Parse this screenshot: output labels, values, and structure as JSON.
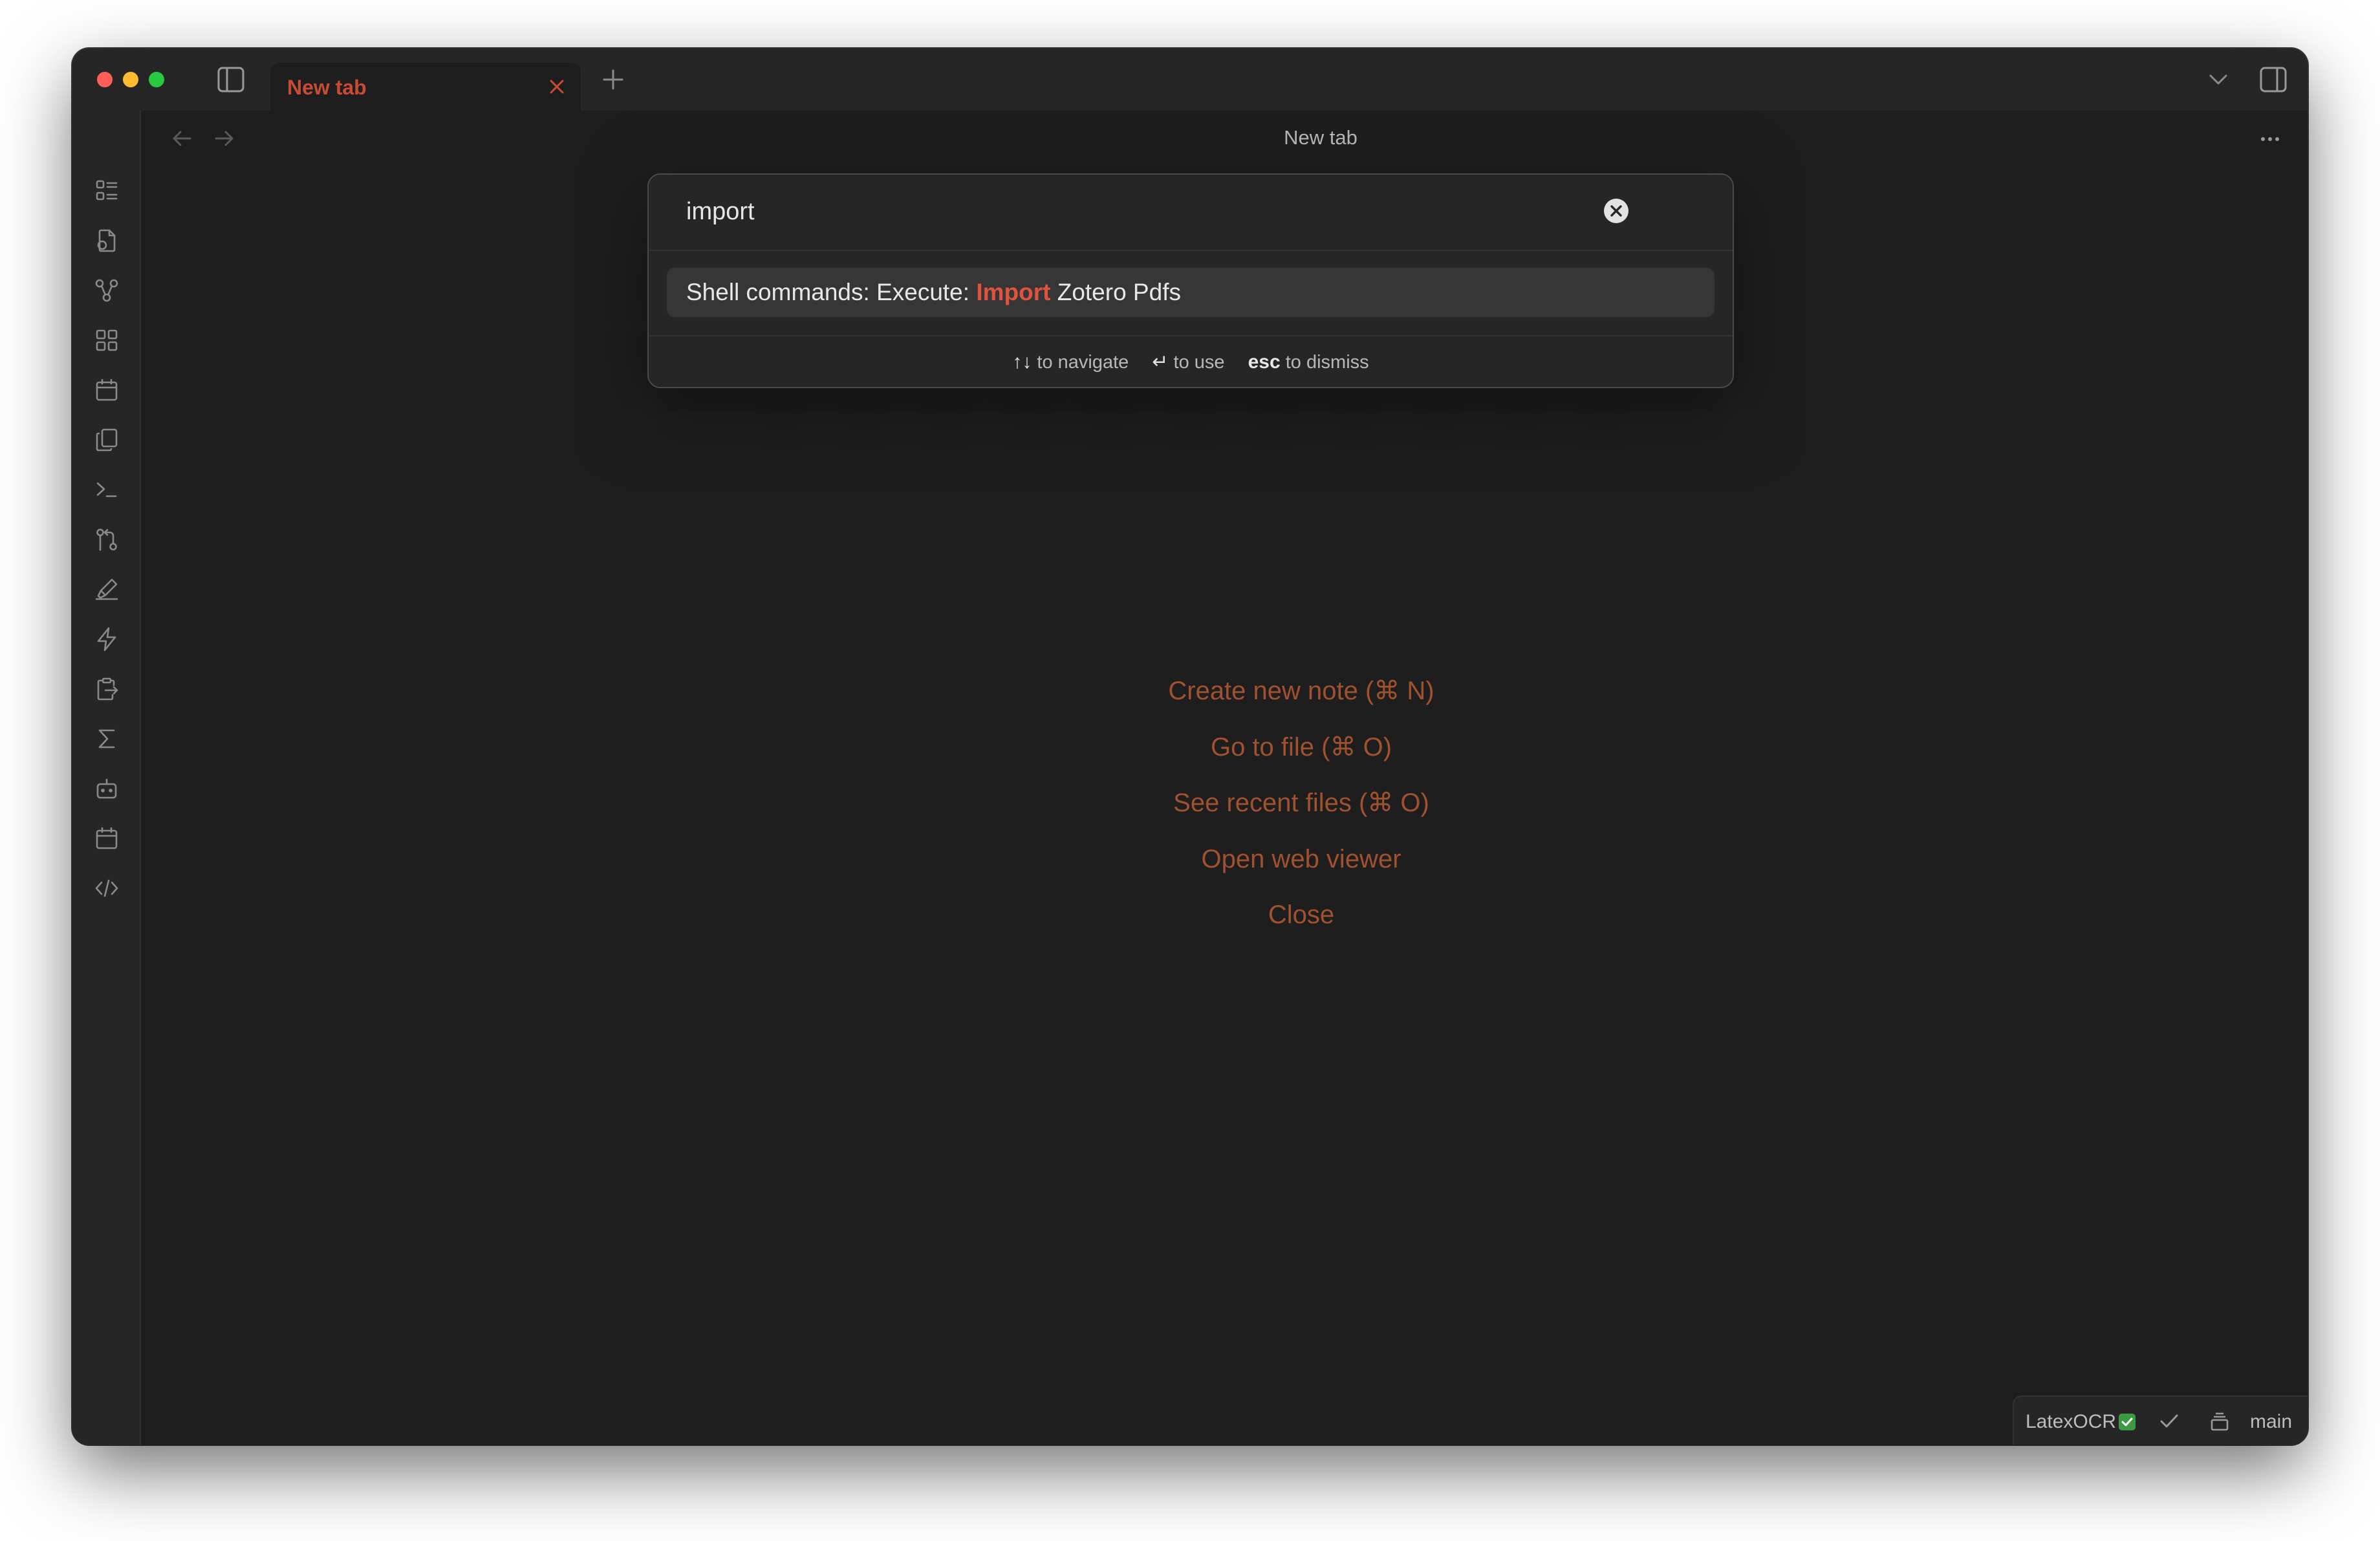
{
  "window": {
    "tab_label": "New tab",
    "view_title": "New tab"
  },
  "ribbon": {
    "icons": [
      "files-list-icon",
      "file-plus-icon",
      "graph-icon",
      "dashboard-grid-icon",
      "calendar-icon",
      "copy-files-icon",
      "terminal-icon",
      "git-compare-icon",
      "highlighter-icon",
      "lightning-icon",
      "clipboard-export-icon",
      "sigma-icon",
      "bot-icon",
      "calendar-alt-icon",
      "code-icon"
    ]
  },
  "palette": {
    "query": "import",
    "suggestion": {
      "prefix": "Shell commands: Execute: ",
      "match": "Import",
      "suffix": " Zotero Pdfs"
    },
    "instructions": [
      {
        "key": "↑↓",
        "text": "to navigate"
      },
      {
        "key": "↵",
        "text": "to use"
      },
      {
        "key": "esc",
        "text": "to dismiss"
      }
    ]
  },
  "empty_state": {
    "actions": [
      "Create new note (⌘ N)",
      "Go to file (⌘ O)",
      "See recent files (⌘ O)",
      "Open web viewer",
      "Close"
    ]
  },
  "statusbar": {
    "latex_ocr": "LatexOCR",
    "branch": "main"
  },
  "colors": {
    "accent": "#c94a35",
    "highlight": "#e0533e",
    "empty_action": "#a0512f",
    "background": "#1e1e1e",
    "chrome": "#262626"
  }
}
